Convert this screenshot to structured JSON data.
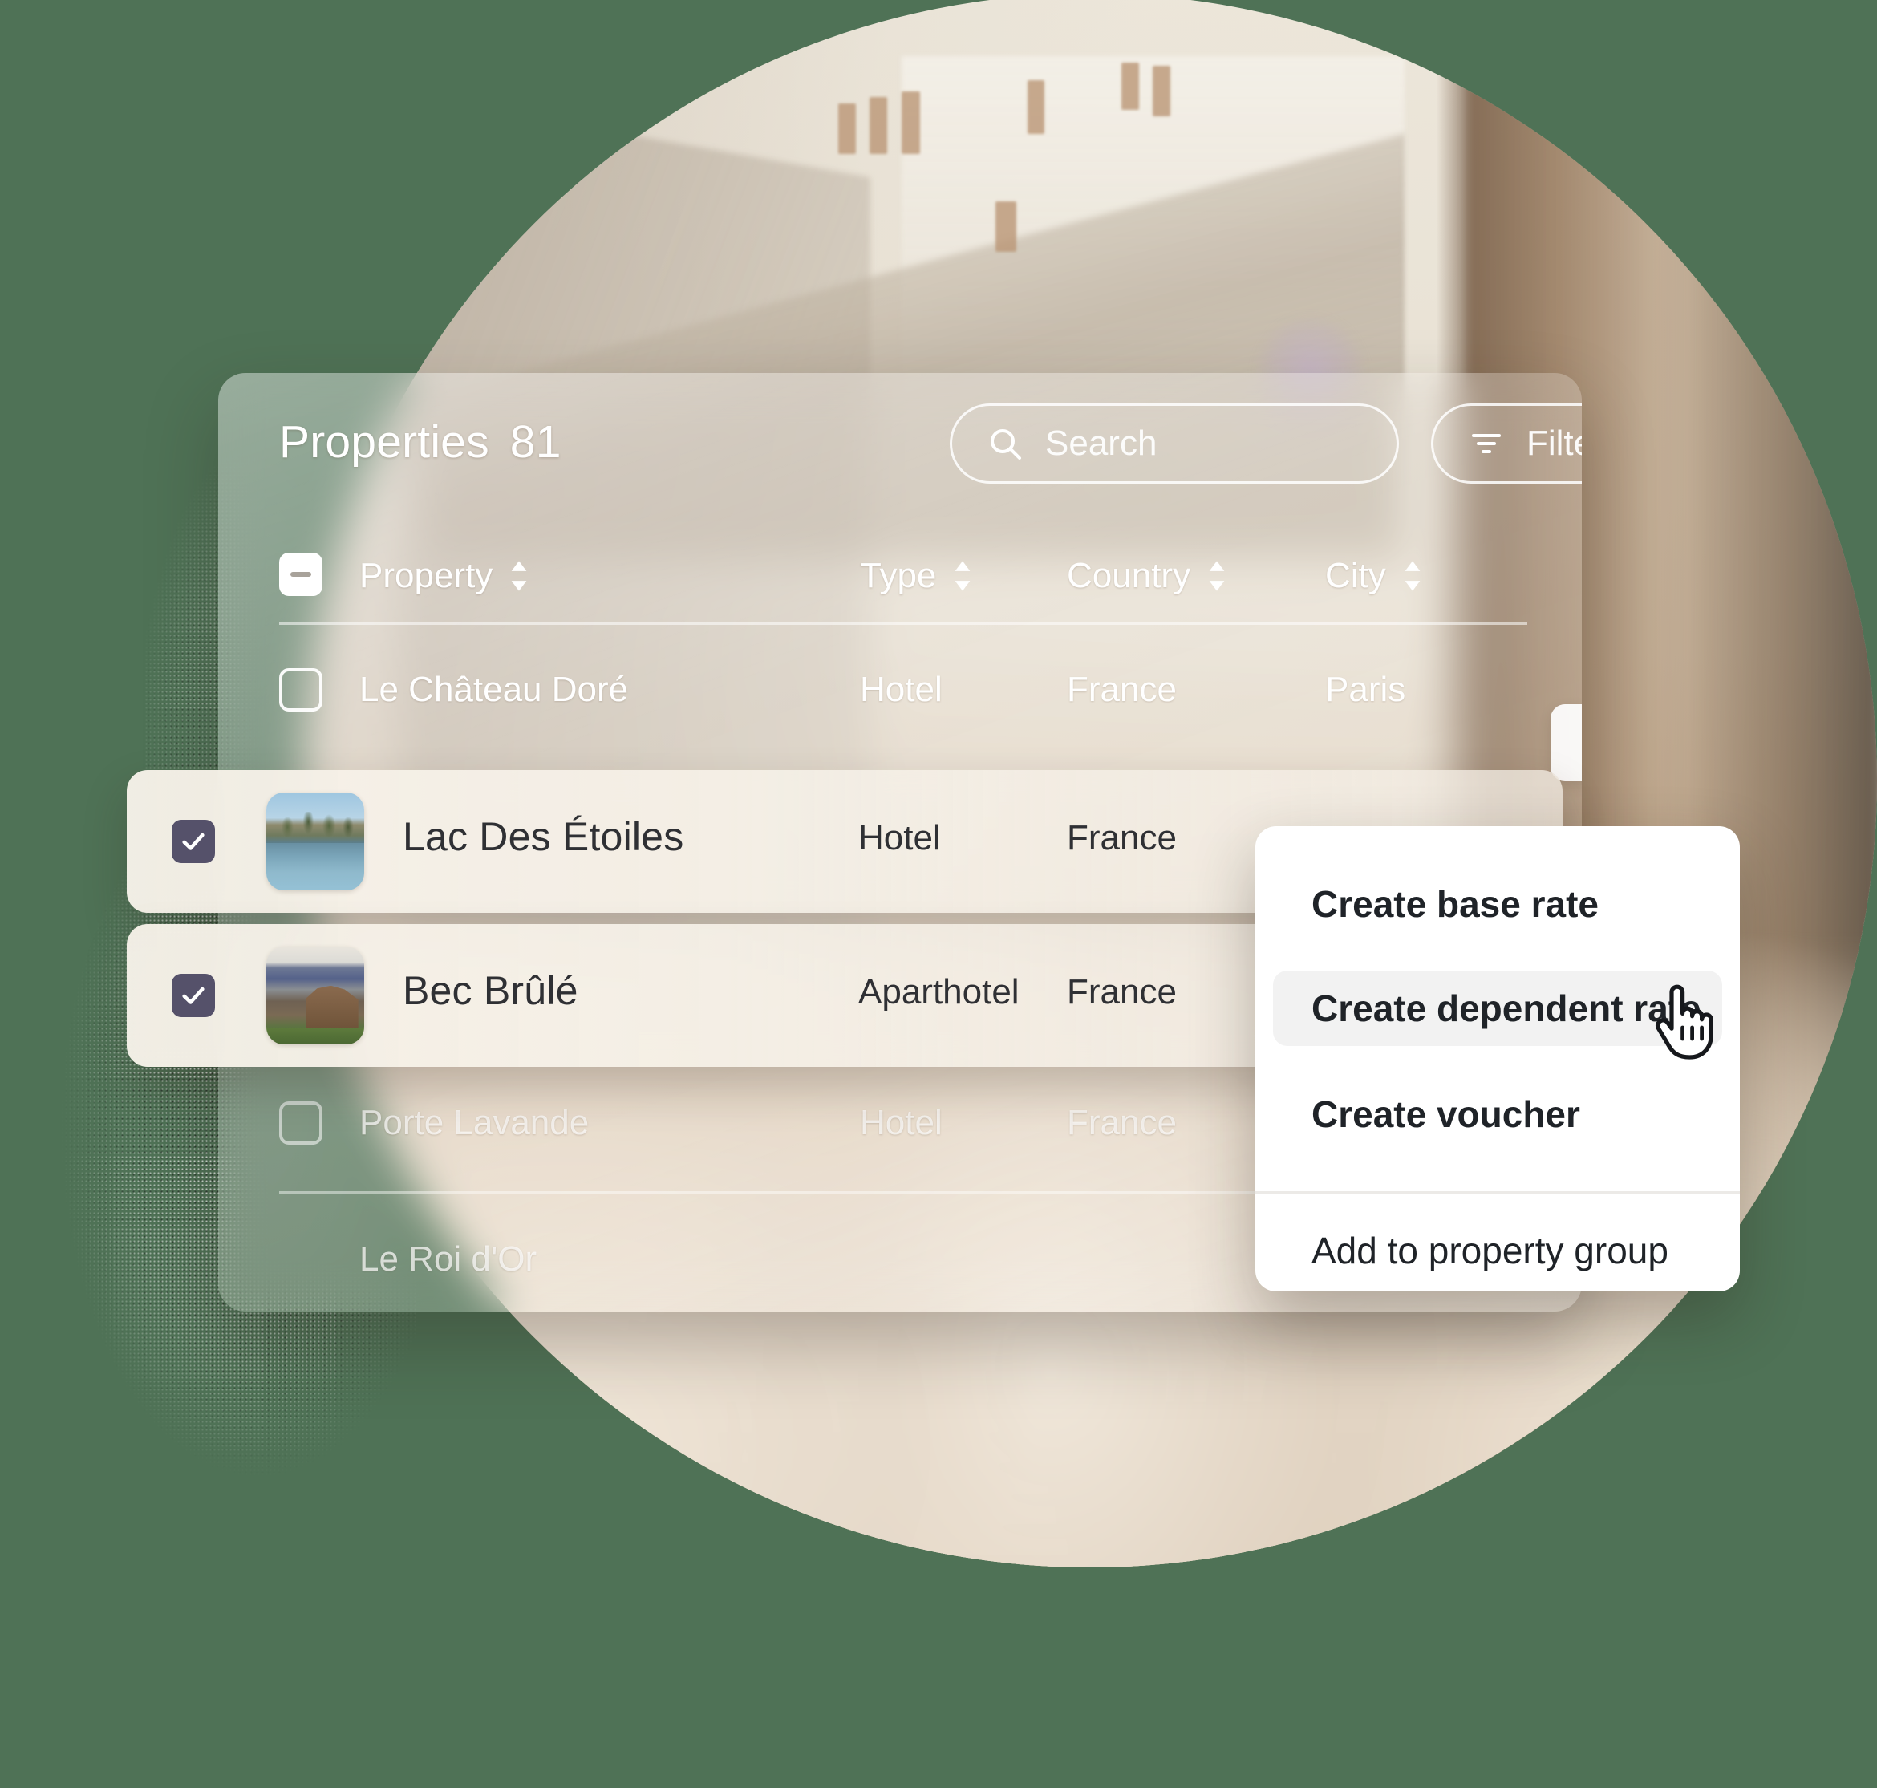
{
  "theme": {
    "background_green": "#4f7256",
    "checkbox_checked": "#55516a",
    "menu_background": "#ffffff",
    "menu_highlight": "#f2f2f2",
    "text_dark": "#1f2328",
    "text_light": "#ffffff"
  },
  "panel": {
    "title": "Properties",
    "count": "81",
    "search": {
      "placeholder": "Search",
      "value": "",
      "icon": "search-icon"
    },
    "filter": {
      "label": "Filter",
      "icon": "filter-icon"
    }
  },
  "table": {
    "select_all_state": "indeterminate",
    "columns": [
      {
        "label": "Property",
        "sortable": true
      },
      {
        "label": "Type",
        "sortable": true
      },
      {
        "label": "Country",
        "sortable": true
      },
      {
        "label": "City",
        "sortable": true
      }
    ],
    "rows": [
      {
        "property": "Le Château Doré",
        "type": "Hotel",
        "country": "France",
        "city": "Paris",
        "selected": false,
        "has_thumbnail": false
      },
      {
        "property": "Lac Des Étoiles",
        "type": "Hotel",
        "country": "France",
        "city": "",
        "selected": true,
        "has_thumbnail": true,
        "thumbnail": "palm-lagoon-photo"
      },
      {
        "property": "Bec Brûlé",
        "type": "Aparthotel",
        "country": "France",
        "city": "",
        "selected": true,
        "has_thumbnail": true,
        "thumbnail": "mountain-mansion-photo"
      },
      {
        "property": "Porte Lavande",
        "type": "Hotel",
        "country": "France",
        "city": "",
        "selected": false,
        "has_thumbnail": false
      },
      {
        "property": "Le Roi d'Or",
        "type": "",
        "country": "",
        "city": "",
        "selected": false,
        "has_thumbnail": false
      }
    ]
  },
  "context_menu": {
    "items": [
      {
        "label": "Create base rate",
        "highlighted": false
      },
      {
        "label": "Create dependent rate",
        "highlighted": true
      },
      {
        "label": "Create voucher",
        "highlighted": false
      },
      {
        "label": "Add to property group",
        "highlighted": false
      }
    ]
  },
  "cursor": {
    "type": "pointing-hand-cursor"
  }
}
